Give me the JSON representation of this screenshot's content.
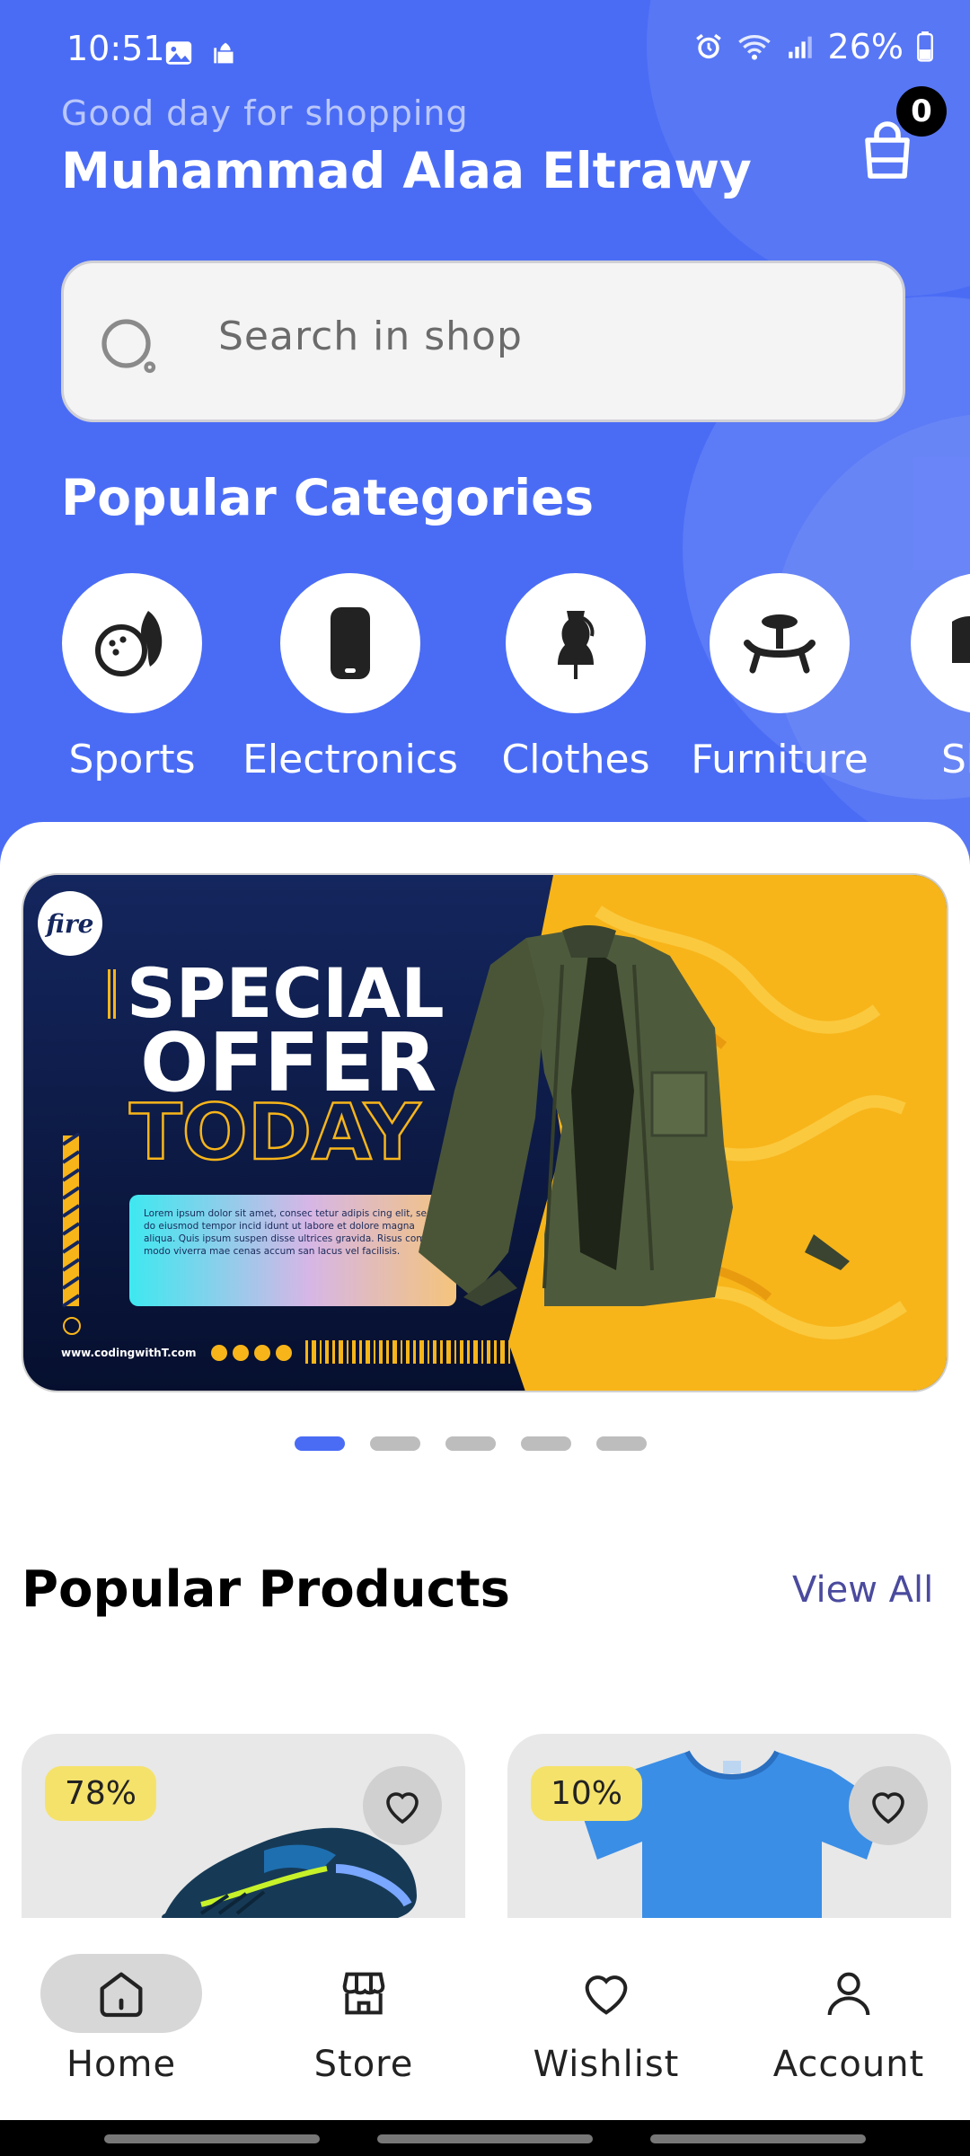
{
  "status": {
    "time": "10:51",
    "battery": "26%"
  },
  "header": {
    "greeting": "Good day for shopping",
    "username": "Muhammad Alaa Eltrawy",
    "cart_count": "0"
  },
  "search": {
    "placeholder": "Search in shop"
  },
  "categories": {
    "title": "Popular Categories",
    "items": [
      {
        "label": "Sports",
        "icon": "sports-icon"
      },
      {
        "label": "Electronics",
        "icon": "phone-icon"
      },
      {
        "label": "Clothes",
        "icon": "mannequin-icon"
      },
      {
        "label": "Furniture",
        "icon": "table-icon"
      },
      {
        "label": "Sh",
        "icon": "shoes-icon"
      }
    ]
  },
  "banner": {
    "logo": "fire",
    "line1": "SPECIAL",
    "line2": "OFFER",
    "line3": "TODAY",
    "body": "Lorem ipsum dolor sit amet, consec tetur adipis cing elit, sed do eiusmod tempor incid idunt ut labore et dolore magna aliqua. Quis ipsum suspen disse ultrices gravida. Risus com modo viverra mae cenas accum san lacus vel facilisis.",
    "website": "www.codingwithT.com",
    "slide_count": 5,
    "active_slide": 1
  },
  "products": {
    "title": "Popular Products",
    "view_all": "View All",
    "items": [
      {
        "discount": "78%",
        "image": "sneaker"
      },
      {
        "discount": "10%",
        "image": "blue-tshirt"
      }
    ]
  },
  "nav": {
    "items": [
      {
        "label": "Home",
        "icon": "home-icon",
        "active": true
      },
      {
        "label": "Store",
        "icon": "store-icon",
        "active": false
      },
      {
        "label": "Wishlist",
        "icon": "heart-icon",
        "active": false
      },
      {
        "label": "Account",
        "icon": "user-icon",
        "active": false
      }
    ]
  },
  "colors": {
    "primary": "#4a6cf5",
    "badge": "#f5e26b",
    "banner_bg": "#0b1f4f",
    "banner_accent": "#f7b51a"
  }
}
